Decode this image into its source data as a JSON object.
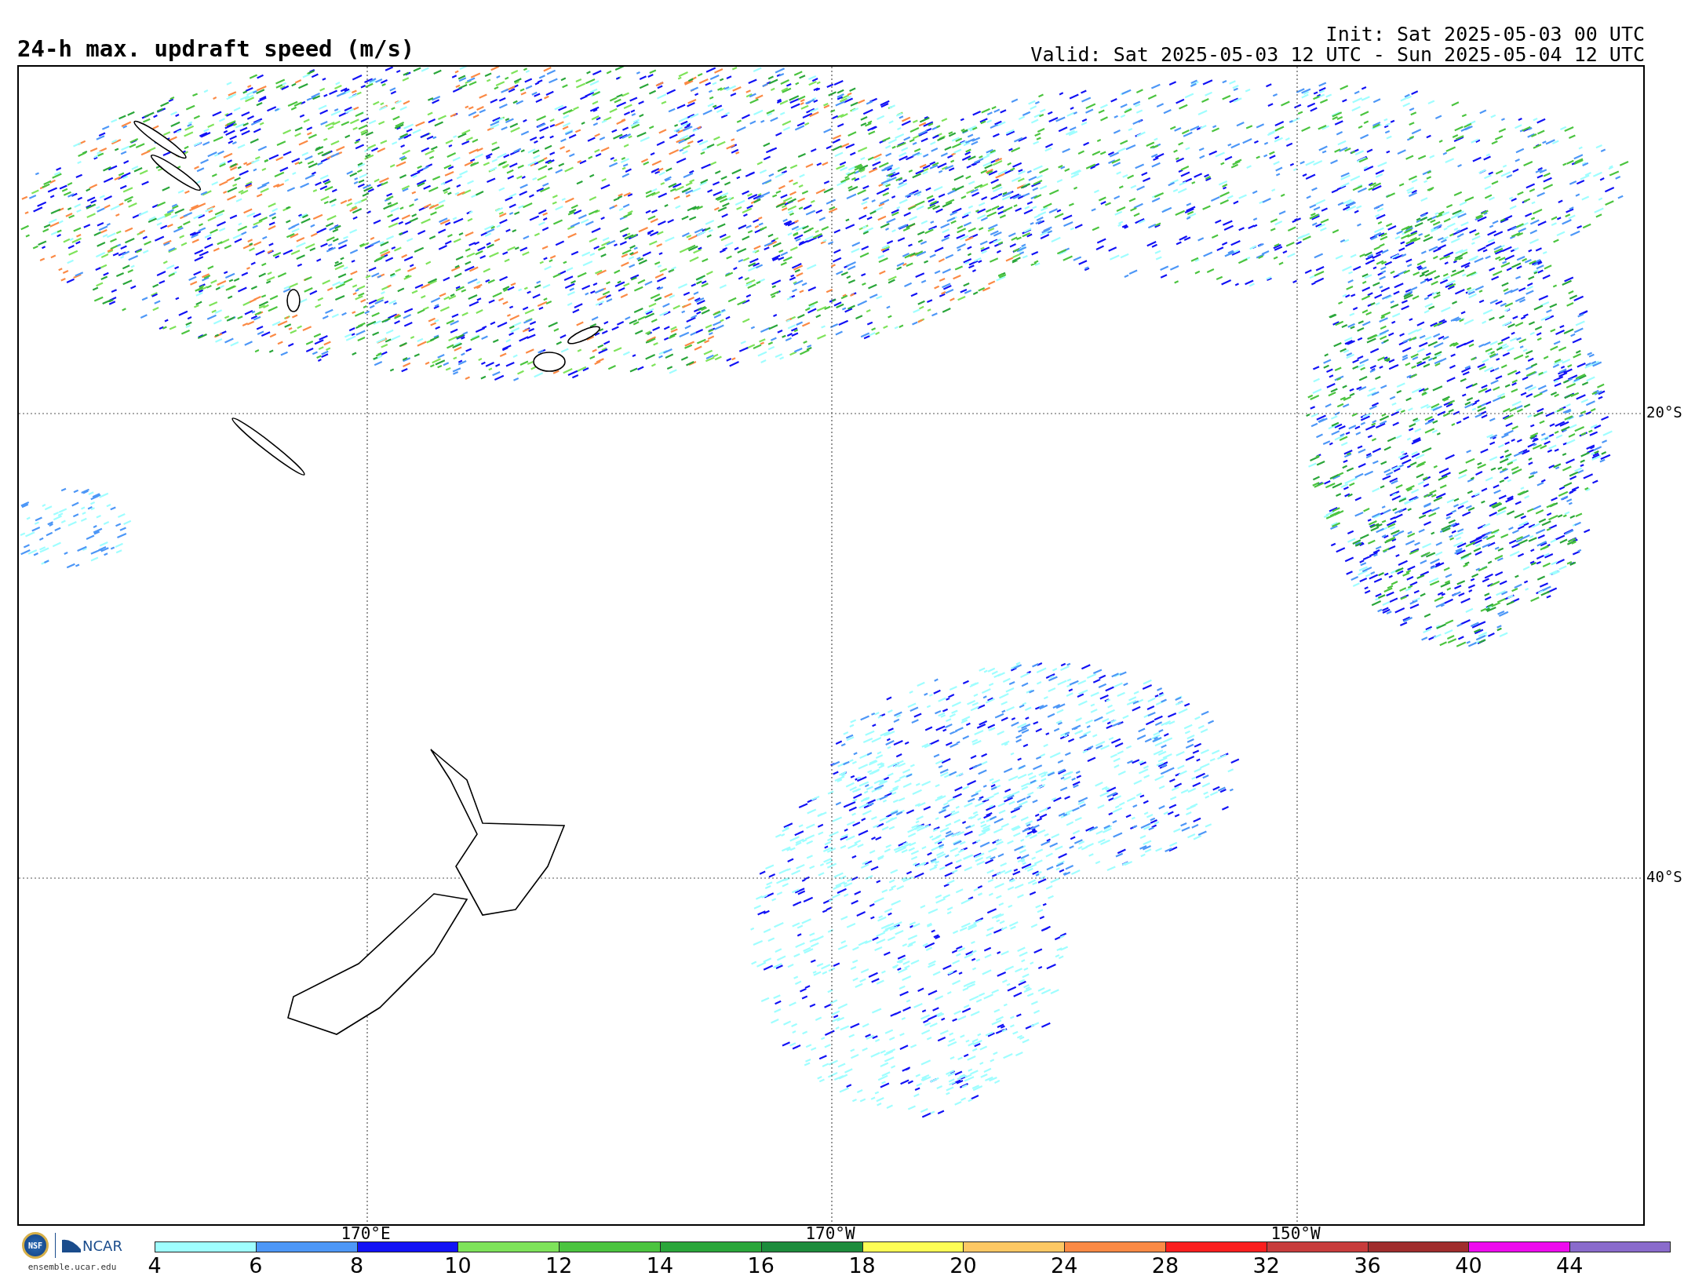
{
  "title": "24-h max. updraft speed (m/s)",
  "init": "Init: Sat 2025-05-03 00 UTC",
  "valid": "Valid: Sat 2025-05-03 12 UTC - Sun 2025-05-04 12 UTC",
  "latitude_labels": [
    "20°S",
    "40°S"
  ],
  "longitude_labels": [
    "170°E",
    "170°W",
    "150°W"
  ],
  "logos": {
    "nsf": "NSF",
    "ncar": "NCAR",
    "site": "ensemble.ucar.edu"
  },
  "legend": {
    "bins": [
      {
        "color": "#9ffeff",
        "tick": "4"
      },
      {
        "color": "#4d97f7",
        "tick": "6"
      },
      {
        "color": "#1212f5",
        "tick": "8"
      },
      {
        "color": "#7ee35a",
        "tick": "10"
      },
      {
        "color": "#4bc43f",
        "tick": "12"
      },
      {
        "color": "#2aa63a",
        "tick": "14"
      },
      {
        "color": "#1d8c3c",
        "tick": "16"
      },
      {
        "color": "#fdfd55",
        "tick": "18"
      },
      {
        "color": "#fdc864",
        "tick": "20"
      },
      {
        "color": "#fb8a45",
        "tick": "24"
      },
      {
        "color": "#fb1e1e",
        "tick": "28"
      },
      {
        "color": "#c83c3c",
        "tick": "32"
      },
      {
        "color": "#a02d2d",
        "tick": "36"
      },
      {
        "color": "#ee0bee",
        "tick": "40"
      },
      {
        "color": "#8a6bcc",
        "tick": "44"
      }
    ]
  }
}
